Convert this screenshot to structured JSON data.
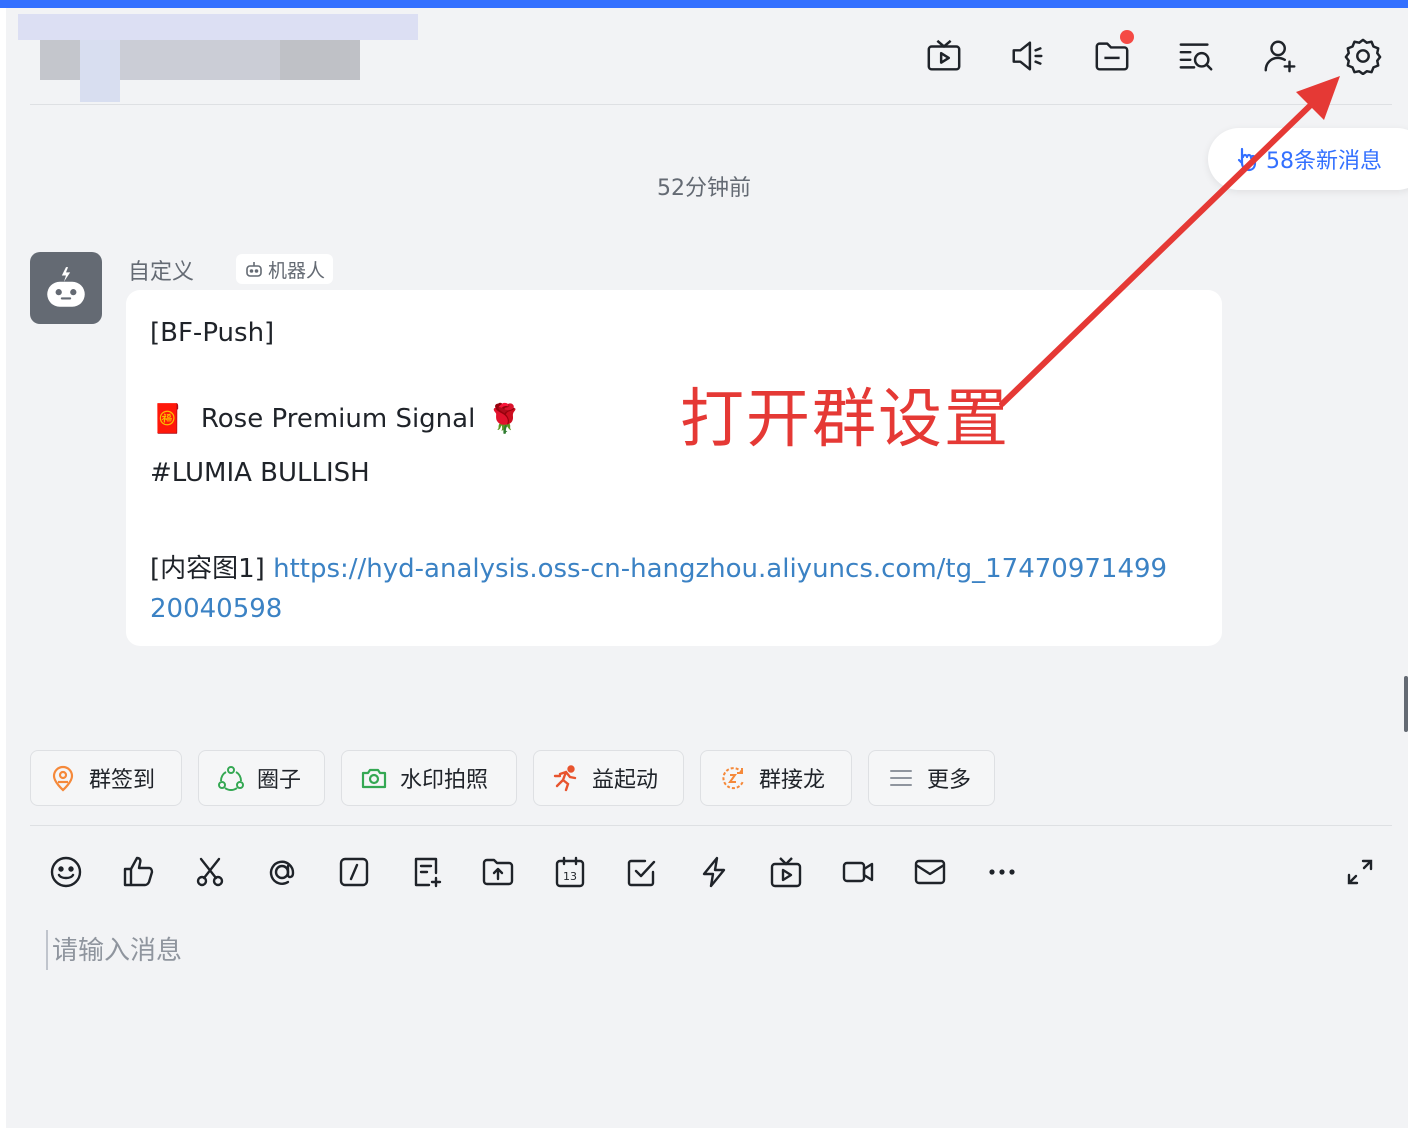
{
  "header": {
    "icons": [
      "live-icon",
      "announcement-icon",
      "folder-icon",
      "search-history-icon",
      "add-member-icon",
      "settings-icon"
    ],
    "folder_has_dot": true
  },
  "new_messages": {
    "label": "58条新消息",
    "icon": "pointer-down-icon"
  },
  "chat": {
    "timestamp": "52分钟前",
    "message": {
      "sender": "自定义",
      "tag": "机器人",
      "line1": "[BF-Push]",
      "line2_emoji_left": "🧧",
      "line2_text": "Rose Premium Signal",
      "line2_emoji_right": "🌹",
      "line3": "#LUMIA BULLISH",
      "line4_prefix": "[内容图1]",
      "link_part1": "https://hyd-analysis.oss-cn-hangzhou.aliyuncs.com/tg_17470971499",
      "link_part2": "20040598"
    }
  },
  "annotation": {
    "text": "打开群设置",
    "color": "#e53935"
  },
  "quick_actions": [
    {
      "label": "群签到",
      "icon": "location-pin-icon",
      "color": "#f5893a"
    },
    {
      "label": "圈子",
      "icon": "circle-group-icon",
      "color": "#34a853"
    },
    {
      "label": "水印拍照",
      "icon": "camera-icon",
      "color": "#34a853"
    },
    {
      "label": "益起动",
      "icon": "running-icon",
      "color": "#e8542e"
    },
    {
      "label": "群接龙",
      "icon": "relay-icon",
      "color": "#f5893a"
    },
    {
      "label": "更多",
      "icon": "menu-icon",
      "color": "#8f959e"
    }
  ],
  "toolbar": {
    "icons": [
      "emoji-icon",
      "thumbs-up-icon",
      "scissors-icon",
      "mention-icon",
      "slash-command-icon",
      "doc-add-icon",
      "upload-file-icon",
      "calendar-icon",
      "task-check-icon",
      "lightning-icon",
      "live-icon",
      "video-call-icon",
      "mail-icon",
      "more-icon",
      "expand-icon"
    ],
    "calendar_day": "13"
  },
  "composer": {
    "placeholder": "请输入消息"
  },
  "colors": {
    "accent": "#3370ff",
    "link": "#3b82c4",
    "annotation": "#e53935"
  }
}
